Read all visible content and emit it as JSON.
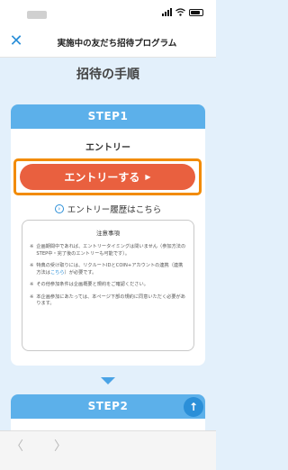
{
  "nav": {
    "title": "実施中の友だち招待プログラム",
    "close_glyph": "✕"
  },
  "section_title": "招待の手順",
  "step1": {
    "header": "STEP1",
    "entry_label": "エントリー",
    "cta_label": "エントリーする",
    "cta_arrow": "▶",
    "history_icon": "›",
    "history_link": "エントリー履歴はこちら"
  },
  "notes": {
    "title": "注意事項",
    "items": [
      {
        "mark": "※",
        "text": "企画期間中であれば、エントリータイミングは問いません（参加方法のSTEP中・完了後のエントリーも可能です）。"
      },
      {
        "mark": "※",
        "text_before": "特典の受け取りには、リクルートIDとCOIN+アカウントの連携（連携方法は",
        "link": "こちら",
        "text_after": "）が必要です。"
      },
      {
        "mark": "※",
        "text": "その他参加条件は企画概要と規約をご確認ください。"
      },
      {
        "mark": "※",
        "text": "本企画参加にあたっては、本ページ下部の規約に同意いただく必要があります。"
      }
    ]
  },
  "step2": {
    "header": "STEP2"
  },
  "scroll_top_glyph": "↑",
  "bottom_nav": {
    "back_glyph": "〈",
    "forward_glyph": "〉"
  },
  "colors": {
    "accent_blue": "#5cb0ea",
    "cta_orange": "#e9603f",
    "highlight_orange": "#f28b00",
    "background": "#e3f0fb"
  }
}
